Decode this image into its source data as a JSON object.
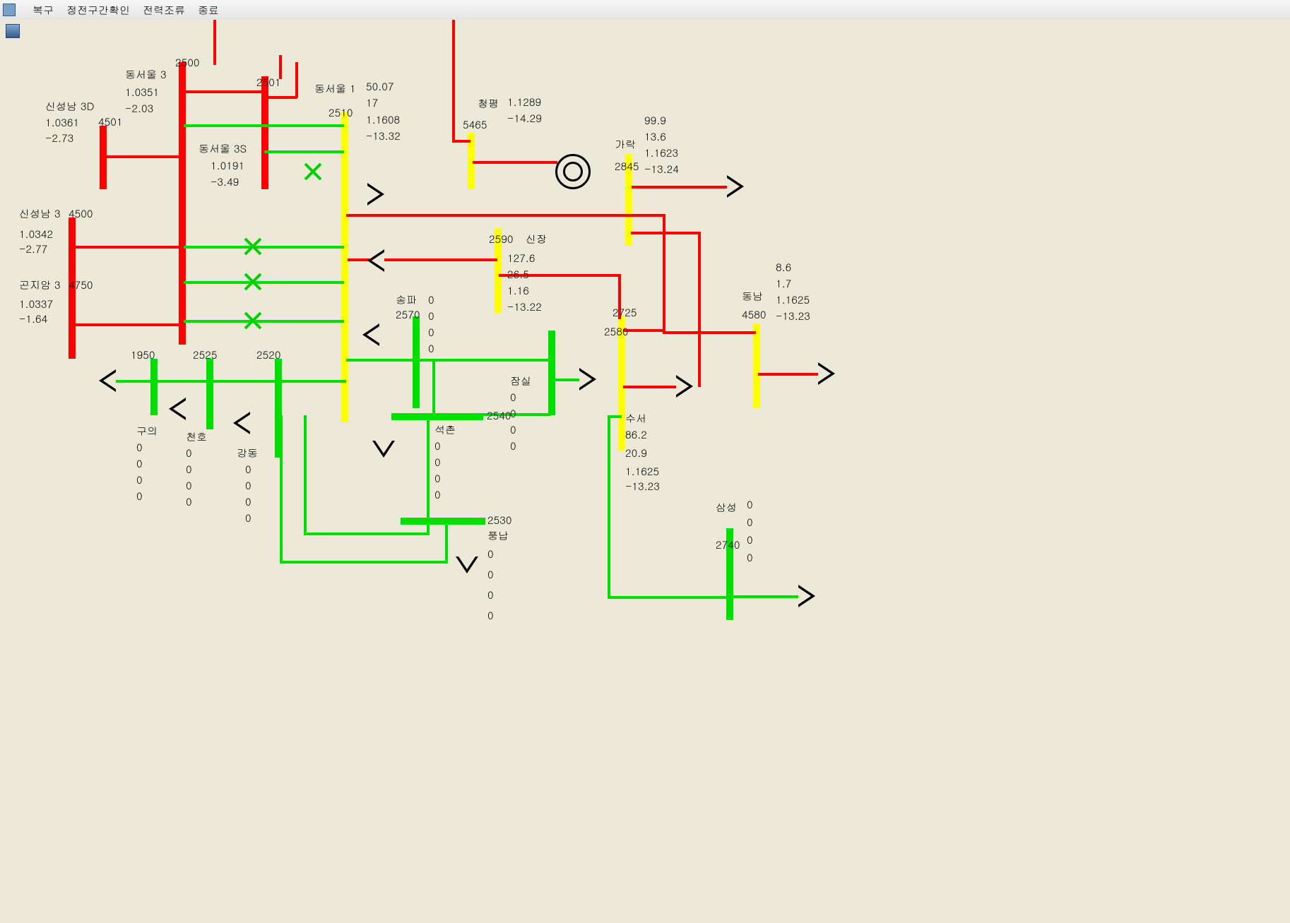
{
  "menu": {
    "m1": "복구",
    "m2": "정전구간확인",
    "m3": "전력조류",
    "m4": "종료"
  },
  "nodes": {
    "sinseongnam3D": {
      "name": "신성남 3D",
      "id": "4501",
      "v": "1.0361",
      "a": "-2.73"
    },
    "sinseongnam3": {
      "name": "신성남 3",
      "id": "4500",
      "v": "1.0342",
      "a": "-2.77"
    },
    "gonjiam3": {
      "name": "곤지암 3",
      "id": "4750",
      "v": "1.0337",
      "a": "-1.64"
    },
    "dongseoul3": {
      "name": "동서울 3",
      "id": "2500",
      "v": "1.0351",
      "a": "-2.03"
    },
    "dongseoul3S": {
      "name": "동서울 3S",
      "id": "2501",
      "v": "1.0191",
      "a": "-3.49"
    },
    "dongseoul1": {
      "name": "동서울 1",
      "id": "2510",
      "p": "50.07",
      "q": "17",
      "v": "1.1608",
      "a": "-13.32"
    },
    "cheongpyeong": {
      "name": "청평",
      "id": "5465",
      "v": "1.1289",
      "a": "-14.29"
    },
    "garak": {
      "name": "가락",
      "id": "2845",
      "p": "99.9",
      "q": "13.6",
      "v": "1.1623",
      "a": "-13.24"
    },
    "sinjang": {
      "name": "신장",
      "id": "2590",
      "p": "127.6",
      "q": "26.5",
      "v": "1.16",
      "a": "-13.22"
    },
    "songpa": {
      "name": "송파",
      "id": "2570",
      "p": "0",
      "q": "0",
      "v": "0",
      "a": "0"
    },
    "jamsil": {
      "name": "잠실",
      "id": "2580",
      "p": "0",
      "q": "0",
      "v": "0",
      "a": "0"
    },
    "suseo": {
      "name": "수서",
      "id": "2725",
      "p": "86.2",
      "q": "20.9",
      "v": "1.1625",
      "a": "-13.23"
    },
    "dongnam": {
      "name": "동남",
      "id": "4580",
      "p": "8.6",
      "q": "1.7",
      "v": "1.1625",
      "a": "-13.23"
    },
    "seokchon": {
      "name": "석촌",
      "id": "2540",
      "p": "0",
      "q": "0",
      "v": "0",
      "a": "0"
    },
    "gangdong": {
      "name": "강동",
      "id": "2520",
      "p": "0",
      "q": "0",
      "v": "0",
      "a": "0"
    },
    "cheonho": {
      "name": "천호",
      "id": "2525",
      "p": "0",
      "q": "0",
      "v": "0",
      "a": "0"
    },
    "guui": {
      "name": "구의",
      "id": "1950",
      "p": "0",
      "q": "0",
      "v": "0",
      "a": "0"
    },
    "pungnap": {
      "name": "풍납",
      "id": "2530",
      "p": "0",
      "q": "0",
      "v": "0",
      "a": "0"
    },
    "samseong": {
      "name": "삼성",
      "id": "2740",
      "p": "0",
      "q": "0",
      "v": "0",
      "a": "0"
    }
  }
}
